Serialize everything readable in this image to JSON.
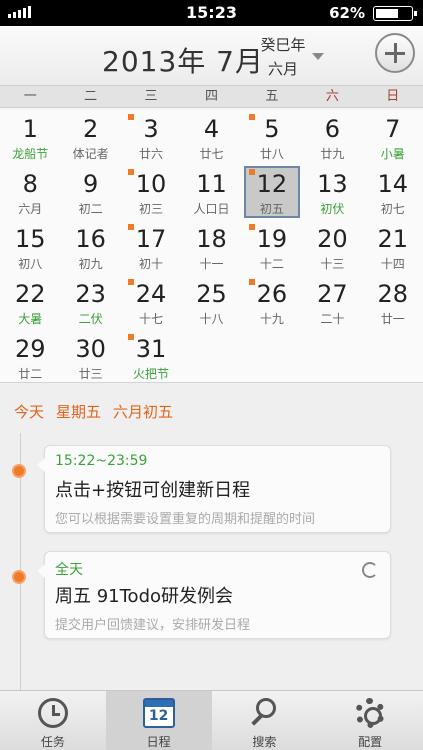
{
  "status_bar": {
    "time": "15:23",
    "battery": "62%",
    "battery_level": 0.62
  },
  "header": {
    "year_month": "2013年 7月",
    "lunar_year": "癸巳年",
    "lunar_month": "六月"
  },
  "weekdays": [
    "一",
    "二",
    "三",
    "四",
    "五",
    "六",
    "日"
  ],
  "calendar": {
    "days": [
      {
        "day": "1",
        "sub": "龙船节",
        "green": true,
        "dot": false
      },
      {
        "day": "2",
        "sub": "体记者",
        "green": false,
        "dot": false
      },
      {
        "day": "3",
        "sub": "廿六",
        "green": false,
        "dot": true
      },
      {
        "day": "4",
        "sub": "廿七",
        "green": false,
        "dot": false
      },
      {
        "day": "5",
        "sub": "廿八",
        "green": false,
        "dot": true
      },
      {
        "day": "6",
        "sub": "廿九",
        "green": false,
        "dot": false
      },
      {
        "day": "7",
        "sub": "小暑",
        "green": true,
        "dot": false
      },
      {
        "day": "8",
        "sub": "六月",
        "green": false,
        "dot": false
      },
      {
        "day": "9",
        "sub": "初二",
        "green": false,
        "dot": false
      },
      {
        "day": "10",
        "sub": "初三",
        "green": false,
        "dot": true
      },
      {
        "day": "11",
        "sub": "人口日",
        "green": false,
        "dot": false
      },
      {
        "day": "12",
        "sub": "初五",
        "green": false,
        "dot": true,
        "today": true
      },
      {
        "day": "13",
        "sub": "初伏",
        "green": true,
        "dot": false
      },
      {
        "day": "14",
        "sub": "初七",
        "green": false,
        "dot": false
      },
      {
        "day": "15",
        "sub": "初八",
        "green": false,
        "dot": false
      },
      {
        "day": "16",
        "sub": "初九",
        "green": false,
        "dot": false
      },
      {
        "day": "17",
        "sub": "初十",
        "green": false,
        "dot": true
      },
      {
        "day": "18",
        "sub": "十一",
        "green": false,
        "dot": false
      },
      {
        "day": "19",
        "sub": "十二",
        "green": false,
        "dot": true
      },
      {
        "day": "20",
        "sub": "十三",
        "green": false,
        "dot": false
      },
      {
        "day": "21",
        "sub": "十四",
        "green": false,
        "dot": false
      },
      {
        "day": "22",
        "sub": "大暑",
        "green": true,
        "dot": false
      },
      {
        "day": "23",
        "sub": "二伏",
        "green": true,
        "dot": false
      },
      {
        "day": "24",
        "sub": "十七",
        "green": false,
        "dot": true
      },
      {
        "day": "25",
        "sub": "十八",
        "green": false,
        "dot": false
      },
      {
        "day": "26",
        "sub": "十九",
        "green": false,
        "dot": true
      },
      {
        "day": "27",
        "sub": "二十",
        "green": false,
        "dot": false
      },
      {
        "day": "28",
        "sub": "廿一",
        "green": false,
        "dot": false
      },
      {
        "day": "29",
        "sub": "廿二",
        "green": false,
        "dot": false
      },
      {
        "day": "30",
        "sub": "廿三",
        "green": false,
        "dot": false
      },
      {
        "day": "31",
        "sub": "火把节",
        "green": true,
        "dot": true
      }
    ]
  },
  "day_header": {
    "today": "今天",
    "weekday": "星期五",
    "lunar_date": "六月初五"
  },
  "events": [
    {
      "time": "15:22~23:59",
      "title": "点击+按钮可创建新日程",
      "desc": "您可以根据需要设置重复的周期和提醒的时间",
      "repeat": false
    },
    {
      "time": "全天",
      "title": "周五 91Todo研发例会",
      "desc": "提交用户回馈建议，安排研发日程",
      "repeat": true
    }
  ],
  "tabs": [
    {
      "label": "任务",
      "icon": "clock-icon"
    },
    {
      "label": "日程",
      "icon": "calendar-icon",
      "icon_text": "12",
      "active": true
    },
    {
      "label": "搜索",
      "icon": "search-icon"
    },
    {
      "label": "配置",
      "icon": "gear-icon"
    }
  ],
  "colors": {
    "accent": "#f07a27",
    "green": "#3aa23a",
    "weekend": "#a3402e",
    "today_border": "#6e85a8"
  }
}
